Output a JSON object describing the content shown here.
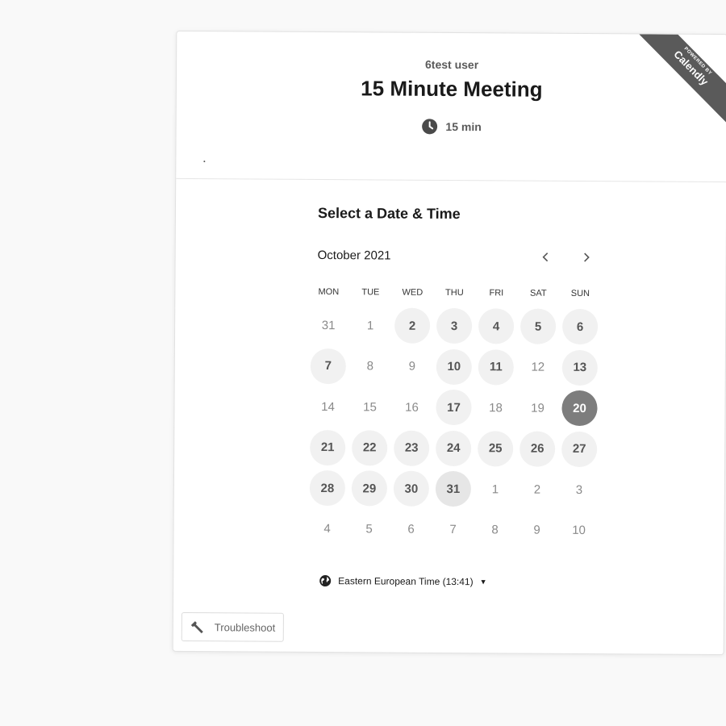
{
  "ribbon": {
    "top_text": "POWERED BY",
    "brand": "Calendly"
  },
  "header": {
    "organizer": "6test user",
    "event_title": "15 Minute Meeting",
    "duration": "15 min",
    "clock_icon": "clock-icon"
  },
  "calendar": {
    "section_title": "Select a Date & Time",
    "month_label": "October 2021",
    "prev_icon": "chevron-left-icon",
    "next_icon": "chevron-right-icon",
    "weekdays": [
      "MON",
      "TUE",
      "WED",
      "THU",
      "FRI",
      "SAT",
      "SUN"
    ],
    "days": [
      {
        "label": "31",
        "state": "outside"
      },
      {
        "label": "1",
        "state": "unavailable"
      },
      {
        "label": "2",
        "state": "available"
      },
      {
        "label": "3",
        "state": "available"
      },
      {
        "label": "4",
        "state": "available"
      },
      {
        "label": "5",
        "state": "available"
      },
      {
        "label": "6",
        "state": "available"
      },
      {
        "label": "7",
        "state": "available"
      },
      {
        "label": "8",
        "state": "unavailable"
      },
      {
        "label": "9",
        "state": "unavailable"
      },
      {
        "label": "10",
        "state": "available"
      },
      {
        "label": "11",
        "state": "available"
      },
      {
        "label": "12",
        "state": "unavailable"
      },
      {
        "label": "13",
        "state": "available"
      },
      {
        "label": "14",
        "state": "unavailable"
      },
      {
        "label": "15",
        "state": "unavailable"
      },
      {
        "label": "16",
        "state": "unavailable"
      },
      {
        "label": "17",
        "state": "available"
      },
      {
        "label": "18",
        "state": "unavailable"
      },
      {
        "label": "19",
        "state": "unavailable"
      },
      {
        "label": "20",
        "state": "selected"
      },
      {
        "label": "21",
        "state": "available"
      },
      {
        "label": "22",
        "state": "available"
      },
      {
        "label": "23",
        "state": "available"
      },
      {
        "label": "24",
        "state": "available"
      },
      {
        "label": "25",
        "state": "available"
      },
      {
        "label": "26",
        "state": "available"
      },
      {
        "label": "27",
        "state": "available"
      },
      {
        "label": "28",
        "state": "available"
      },
      {
        "label": "29",
        "state": "available"
      },
      {
        "label": "30",
        "state": "available"
      },
      {
        "label": "31",
        "state": "today"
      },
      {
        "label": "1",
        "state": "outside"
      },
      {
        "label": "2",
        "state": "outside"
      },
      {
        "label": "3",
        "state": "outside"
      },
      {
        "label": "4",
        "state": "outside"
      },
      {
        "label": "5",
        "state": "outside"
      },
      {
        "label": "6",
        "state": "outside"
      },
      {
        "label": "7",
        "state": "outside"
      },
      {
        "label": "8",
        "state": "outside"
      },
      {
        "label": "9",
        "state": "outside"
      },
      {
        "label": "10",
        "state": "outside"
      }
    ]
  },
  "timezone": {
    "label": "Eastern European Time (13:41)",
    "icon": "globe-icon"
  },
  "troubleshoot": {
    "label": "Troubleshoot",
    "icon": "wrench-icon"
  },
  "colors": {
    "selected": "#7d7d7d",
    "available_bg": "#f1f1f1",
    "ribbon": "#5a5a5a"
  }
}
